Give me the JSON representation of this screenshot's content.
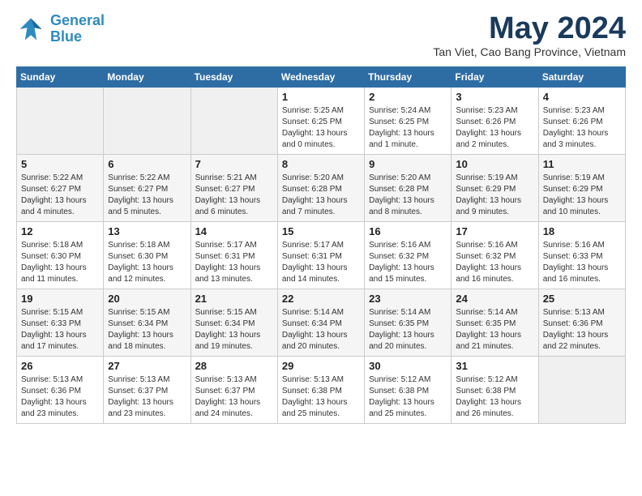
{
  "header": {
    "logo_line1": "General",
    "logo_line2": "Blue",
    "month_title": "May 2024",
    "location": "Tan Viet, Cao Bang Province, Vietnam"
  },
  "weekdays": [
    "Sunday",
    "Monday",
    "Tuesday",
    "Wednesday",
    "Thursday",
    "Friday",
    "Saturday"
  ],
  "weeks": [
    [
      {
        "day": "",
        "empty": true
      },
      {
        "day": "",
        "empty": true
      },
      {
        "day": "",
        "empty": true
      },
      {
        "day": "1",
        "sunrise": "5:25 AM",
        "sunset": "6:25 PM",
        "daylight": "13 hours and 0 minutes."
      },
      {
        "day": "2",
        "sunrise": "5:24 AM",
        "sunset": "6:25 PM",
        "daylight": "13 hours and 1 minute."
      },
      {
        "day": "3",
        "sunrise": "5:23 AM",
        "sunset": "6:26 PM",
        "daylight": "13 hours and 2 minutes."
      },
      {
        "day": "4",
        "sunrise": "5:23 AM",
        "sunset": "6:26 PM",
        "daylight": "13 hours and 3 minutes."
      }
    ],
    [
      {
        "day": "5",
        "sunrise": "5:22 AM",
        "sunset": "6:27 PM",
        "daylight": "13 hours and 4 minutes."
      },
      {
        "day": "6",
        "sunrise": "5:22 AM",
        "sunset": "6:27 PM",
        "daylight": "13 hours and 5 minutes."
      },
      {
        "day": "7",
        "sunrise": "5:21 AM",
        "sunset": "6:27 PM",
        "daylight": "13 hours and 6 minutes."
      },
      {
        "day": "8",
        "sunrise": "5:20 AM",
        "sunset": "6:28 PM",
        "daylight": "13 hours and 7 minutes."
      },
      {
        "day": "9",
        "sunrise": "5:20 AM",
        "sunset": "6:28 PM",
        "daylight": "13 hours and 8 minutes."
      },
      {
        "day": "10",
        "sunrise": "5:19 AM",
        "sunset": "6:29 PM",
        "daylight": "13 hours and 9 minutes."
      },
      {
        "day": "11",
        "sunrise": "5:19 AM",
        "sunset": "6:29 PM",
        "daylight": "13 hours and 10 minutes."
      }
    ],
    [
      {
        "day": "12",
        "sunrise": "5:18 AM",
        "sunset": "6:30 PM",
        "daylight": "13 hours and 11 minutes."
      },
      {
        "day": "13",
        "sunrise": "5:18 AM",
        "sunset": "6:30 PM",
        "daylight": "13 hours and 12 minutes."
      },
      {
        "day": "14",
        "sunrise": "5:17 AM",
        "sunset": "6:31 PM",
        "daylight": "13 hours and 13 minutes."
      },
      {
        "day": "15",
        "sunrise": "5:17 AM",
        "sunset": "6:31 PM",
        "daylight": "13 hours and 14 minutes."
      },
      {
        "day": "16",
        "sunrise": "5:16 AM",
        "sunset": "6:32 PM",
        "daylight": "13 hours and 15 minutes."
      },
      {
        "day": "17",
        "sunrise": "5:16 AM",
        "sunset": "6:32 PM",
        "daylight": "13 hours and 16 minutes."
      },
      {
        "day": "18",
        "sunrise": "5:16 AM",
        "sunset": "6:33 PM",
        "daylight": "13 hours and 16 minutes."
      }
    ],
    [
      {
        "day": "19",
        "sunrise": "5:15 AM",
        "sunset": "6:33 PM",
        "daylight": "13 hours and 17 minutes."
      },
      {
        "day": "20",
        "sunrise": "5:15 AM",
        "sunset": "6:34 PM",
        "daylight": "13 hours and 18 minutes."
      },
      {
        "day": "21",
        "sunrise": "5:15 AM",
        "sunset": "6:34 PM",
        "daylight": "13 hours and 19 minutes."
      },
      {
        "day": "22",
        "sunrise": "5:14 AM",
        "sunset": "6:34 PM",
        "daylight": "13 hours and 20 minutes."
      },
      {
        "day": "23",
        "sunrise": "5:14 AM",
        "sunset": "6:35 PM",
        "daylight": "13 hours and 20 minutes."
      },
      {
        "day": "24",
        "sunrise": "5:14 AM",
        "sunset": "6:35 PM",
        "daylight": "13 hours and 21 minutes."
      },
      {
        "day": "25",
        "sunrise": "5:13 AM",
        "sunset": "6:36 PM",
        "daylight": "13 hours and 22 minutes."
      }
    ],
    [
      {
        "day": "26",
        "sunrise": "5:13 AM",
        "sunset": "6:36 PM",
        "daylight": "13 hours and 23 minutes."
      },
      {
        "day": "27",
        "sunrise": "5:13 AM",
        "sunset": "6:37 PM",
        "daylight": "13 hours and 23 minutes."
      },
      {
        "day": "28",
        "sunrise": "5:13 AM",
        "sunset": "6:37 PM",
        "daylight": "13 hours and 24 minutes."
      },
      {
        "day": "29",
        "sunrise": "5:13 AM",
        "sunset": "6:38 PM",
        "daylight": "13 hours and 25 minutes."
      },
      {
        "day": "30",
        "sunrise": "5:12 AM",
        "sunset": "6:38 PM",
        "daylight": "13 hours and 25 minutes."
      },
      {
        "day": "31",
        "sunrise": "5:12 AM",
        "sunset": "6:38 PM",
        "daylight": "13 hours and 26 minutes."
      },
      {
        "day": "",
        "empty": true
      }
    ]
  ]
}
